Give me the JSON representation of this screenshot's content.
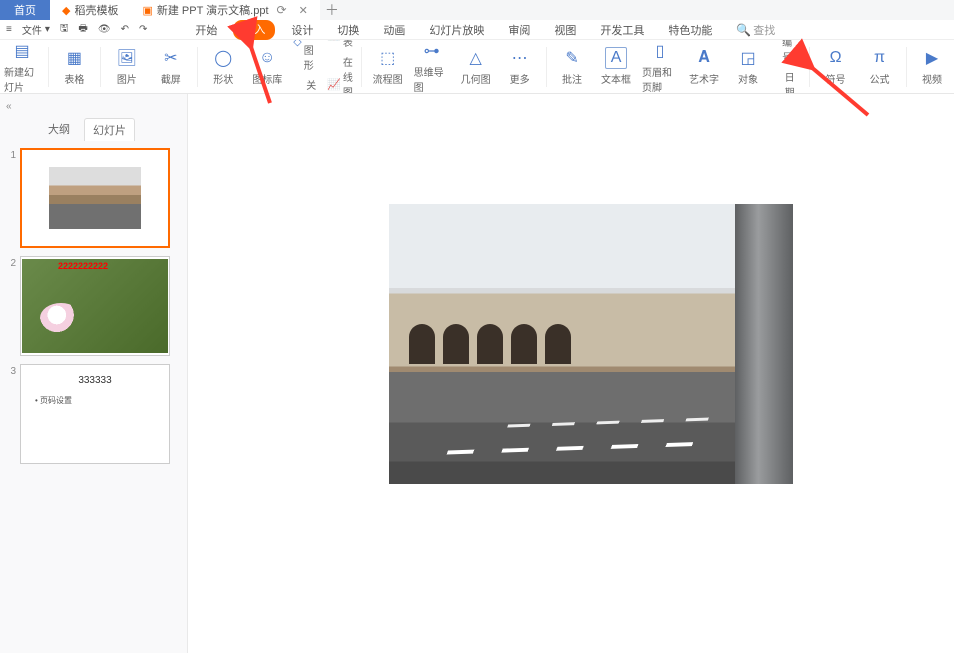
{
  "titlebar": {
    "home": "首页",
    "template": "稻壳模板",
    "doc": "新建 PPT 演示文稿.ppt"
  },
  "menurow": {
    "file": "文件",
    "tabs": [
      "开始",
      "插入",
      "设计",
      "切换",
      "动画",
      "幻灯片放映",
      "审阅",
      "视图",
      "开发工具",
      "特色功能"
    ],
    "active_tab_index": 1,
    "search": "查找"
  },
  "ribbon": {
    "new_slide": "新建幻灯片",
    "table": "表格",
    "picture": "图片",
    "screenshot": "截屏",
    "shape": "形状",
    "icon_lib": "图标库",
    "smart_shape": "智能图形",
    "chart_btn": "图表",
    "relation": "关系图",
    "online_chart": "在线图表",
    "flowchart": "流程图",
    "mindmap": "思维导图",
    "geometry": "几何图",
    "more": "更多",
    "annotate": "批注",
    "textbox": "文本框",
    "header_footer": "页眉和页脚",
    "wordart": "艺术字",
    "object": "对象",
    "datetime": "日期和时间",
    "slide_number": "幻灯片编号",
    "symbol": "符号",
    "formula": "公式",
    "video": "视频"
  },
  "sidepane": {
    "outline_tab": "大纲",
    "slides_tab": "幻灯片",
    "slides": [
      {
        "num": "1"
      },
      {
        "num": "2",
        "label": "2222222222"
      },
      {
        "num": "3",
        "title": "333333",
        "bullet": "页码设置"
      }
    ]
  },
  "colors": {
    "accent": "#ff6a00",
    "primary": "#4a7ac9"
  }
}
